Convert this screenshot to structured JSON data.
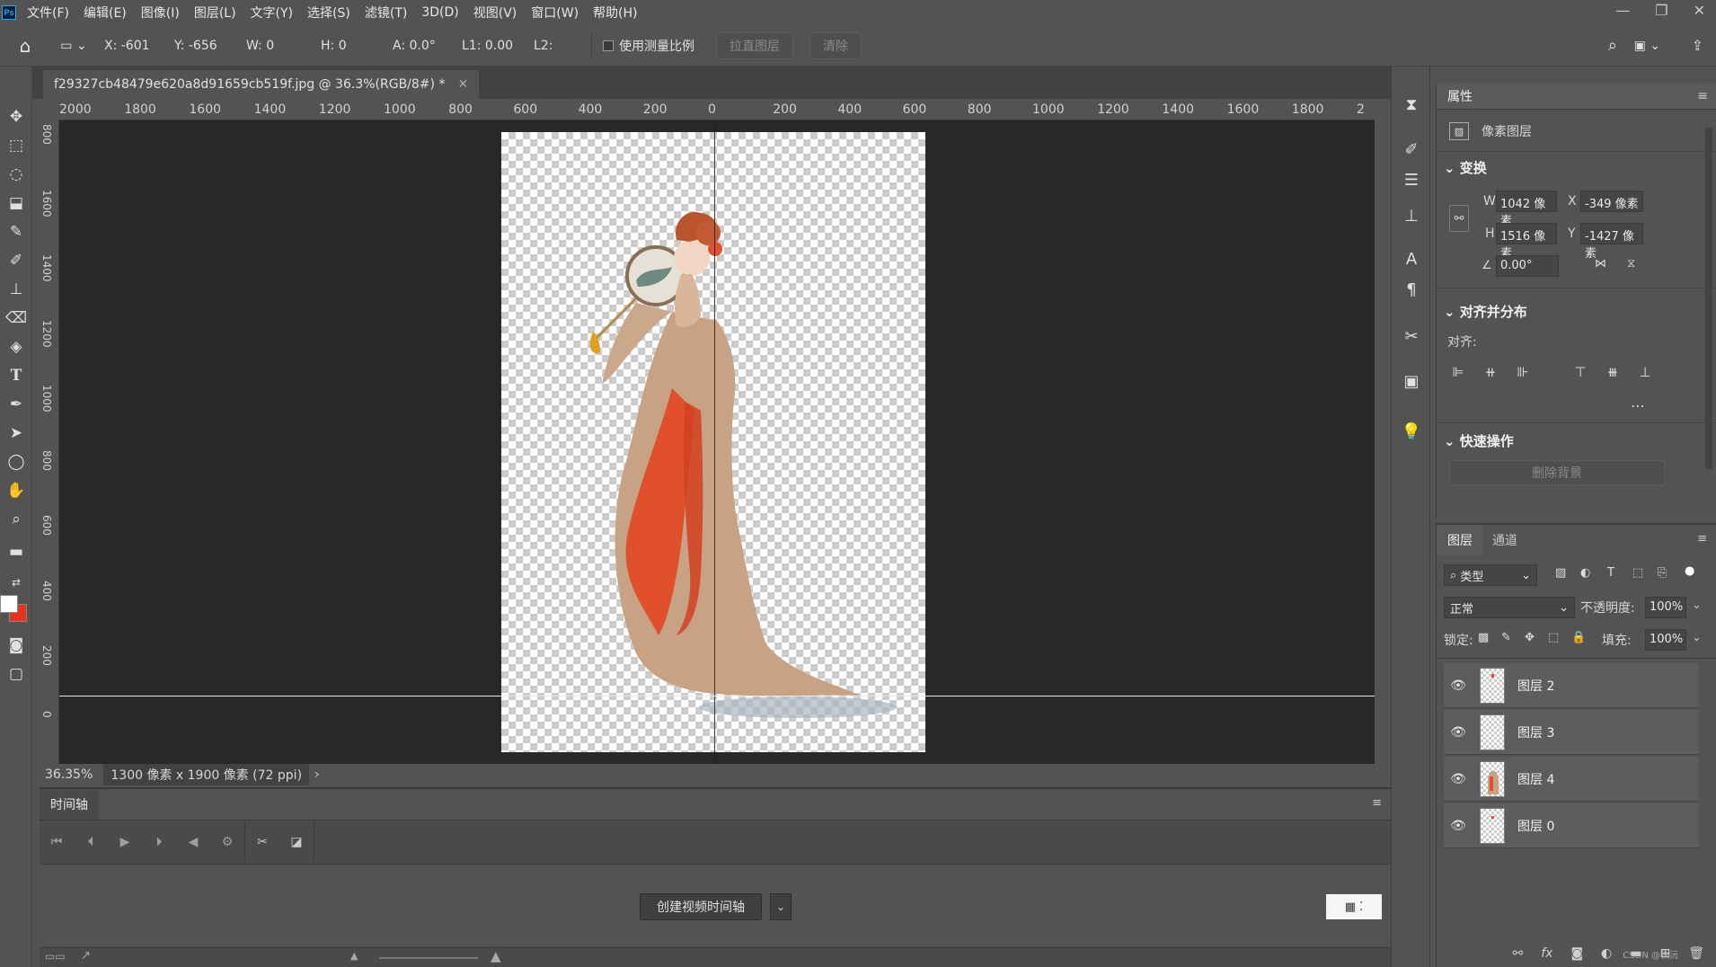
{
  "menu": [
    "文件(F)",
    "编辑(E)",
    "图像(I)",
    "图层(L)",
    "文字(Y)",
    "选择(S)",
    "滤镜(T)",
    "3D(D)",
    "视图(V)",
    "窗口(W)",
    "帮助(H)"
  ],
  "app": {
    "logo": "Ps"
  },
  "options": {
    "x": "X: -601",
    "y": "Y: -656",
    "w": "W: 0",
    "h": "H: 0",
    "a": "A: 0.0°",
    "l1": "L1: 0.00",
    "l2": "L2:",
    "use_scale": "使用测量比例",
    "straighten": "拉直图层",
    "clear": "清除"
  },
  "document": {
    "tab_title": "f29327cb48479e620a8d91659cb519f.jpg @ 36.3%(RGB/8#) *",
    "zoom": "36.35%",
    "info": "1300 像素 x 1900 像素 (72 ppi)"
  },
  "ruler": {
    "top": [
      "2000",
      "1800",
      "1600",
      "1400",
      "1200",
      "1000",
      "800",
      "600",
      "400",
      "200",
      "0",
      "200",
      "400",
      "600",
      "800",
      "1000",
      "1200",
      "1400",
      "1600",
      "1800",
      "2"
    ],
    "left": [
      "800",
      "1600",
      "1400",
      "1200",
      "1000",
      "800",
      "600",
      "400",
      "200",
      "0"
    ]
  },
  "timeline": {
    "tab": "时间轴",
    "create_btn": "创建视频时间轴"
  },
  "properties": {
    "tab": "属性",
    "layer_type": "像素图层",
    "transform_title": "变换",
    "w_label": "W",
    "w_value": "1042 像素",
    "h_label": "H",
    "h_value": "1516 像素",
    "x_label": "X",
    "x_value": "-349 像素",
    "y_label": "Y",
    "y_value": "-1427 像素",
    "angle": "0.00°",
    "align_title": "对齐并分布",
    "align_label": "对齐:",
    "quick_title": "快速操作",
    "remove_bg": "删除背景"
  },
  "layers_panel": {
    "tab_layers": "图层",
    "tab_channels": "通道",
    "filter": "类型",
    "blend_mode": "正常",
    "opacity_label": "不透明度:",
    "opacity": "100%",
    "lock_label": "锁定:",
    "fill_label": "填充:",
    "fill": "100%",
    "layers": [
      {
        "name": "图层 2"
      },
      {
        "name": "图层 3"
      },
      {
        "name": "图层 4"
      },
      {
        "name": "图层 0"
      }
    ],
    "watermark": "CSDN @秋沅"
  },
  "colors": {
    "foreground": "#ffffff",
    "background": "#e8321e",
    "accent": "#31a8ff"
  }
}
